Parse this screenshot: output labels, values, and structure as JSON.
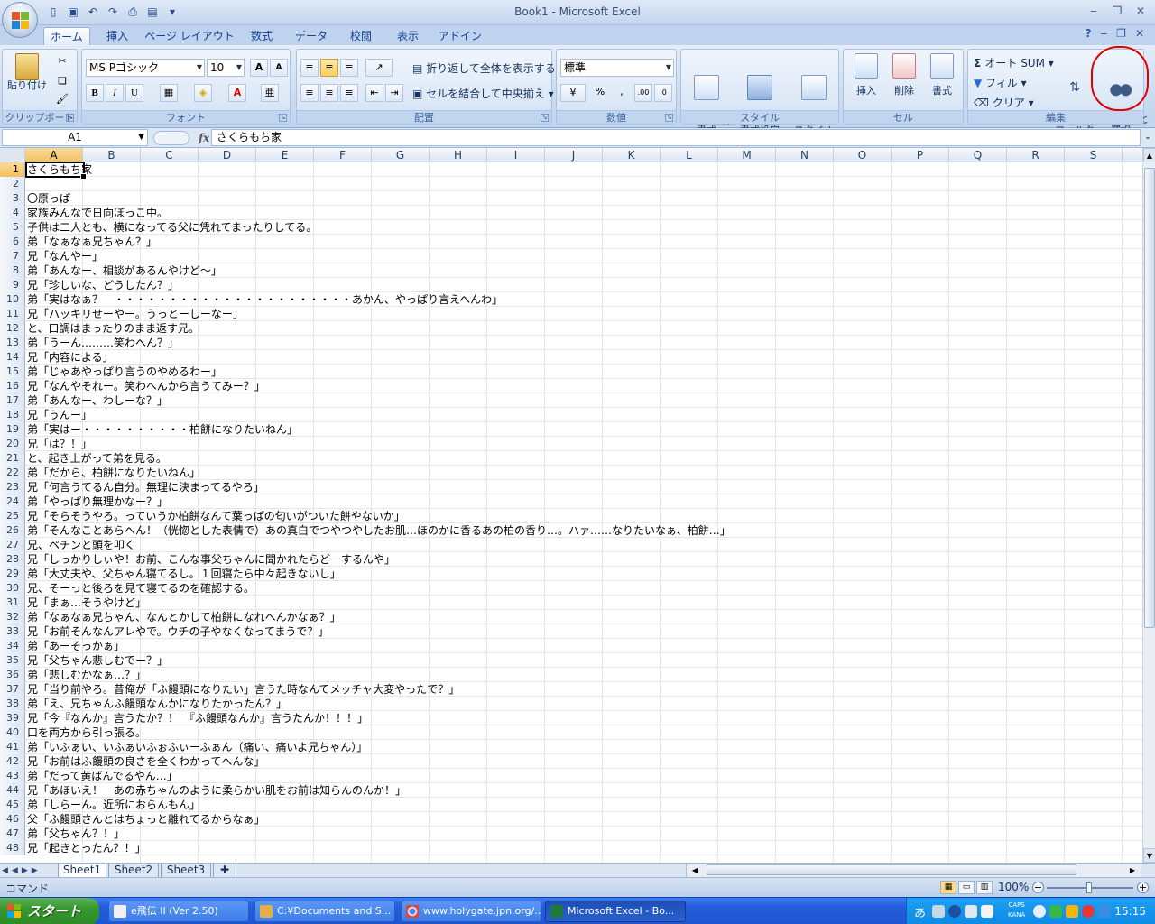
{
  "window": {
    "title": "Book1 - Microsoft Excel"
  },
  "ribbon": {
    "tabs": [
      "ホーム",
      "挿入",
      "ページ レイアウト",
      "数式",
      "データ",
      "校閲",
      "表示",
      "アドイン"
    ],
    "clipboard": {
      "paste": "貼り付け",
      "label": "クリップボード"
    },
    "font": {
      "name": "MS Pゴシック",
      "size": "10",
      "bold": "B",
      "italic": "I",
      "underline": "U",
      "label": "フォント"
    },
    "alignment": {
      "wrap": "折り返して全体を表示する",
      "merge": "セルを結合して中央揃え",
      "label": "配置"
    },
    "number": {
      "format": "標準",
      "percent": "%",
      "comma": ",",
      "label": "数値"
    },
    "styles": {
      "conditional": "条件付き\n書式",
      "table": "テーブルとして\n書式設定",
      "cell": "セルの\nスタイル",
      "label": "スタイル"
    },
    "cells": {
      "insert": "挿入",
      "delete": "削除",
      "format": "書式",
      "label": "セル"
    },
    "editing": {
      "autosum": "オート SUM",
      "fill": "フィル",
      "clear": "クリア",
      "sort": "並べ替えと\nフィルタ",
      "find": "検索と\n選択",
      "label": "編集"
    }
  },
  "formula_bar": {
    "name_box": "A1",
    "fx": "fx",
    "content": "さくらもち家"
  },
  "columns": [
    "A",
    "B",
    "C",
    "D",
    "E",
    "F",
    "G",
    "H",
    "I",
    "J",
    "K",
    "L",
    "M",
    "N",
    "O",
    "P",
    "Q",
    "R",
    "S"
  ],
  "rows": [
    {
      "n": "1",
      "text": "さくらもち家"
    },
    {
      "n": "2",
      "text": ""
    },
    {
      "n": "3",
      "text": "〇原っぱ"
    },
    {
      "n": "4",
      "text": "家族みんなで日向ぼっこ中。"
    },
    {
      "n": "5",
      "text": "子供は二人とも、横になってる父に凭れてまったりしてる。"
    },
    {
      "n": "6",
      "text": "弟「なぁなぁ兄ちゃん？」"
    },
    {
      "n": "7",
      "text": "兄「なんやー」"
    },
    {
      "n": "8",
      "text": "弟「あんなー、相談があるんやけど～」"
    },
    {
      "n": "9",
      "text": "兄「珍しいな、どうしたん？」"
    },
    {
      "n": "10",
      "text": "弟「実はなぁ？　・・・・・・・・・・・・・・・・・・・・・・あかん、やっぱり言えへんわ」"
    },
    {
      "n": "11",
      "text": "兄「ハッキリせーやー。うっとーしーなー」"
    },
    {
      "n": "12",
      "text": "と、口調はまったりのまま返す兄。"
    },
    {
      "n": "13",
      "text": "弟「うーん………笑わへん？」"
    },
    {
      "n": "14",
      "text": "兄「内容による」"
    },
    {
      "n": "15",
      "text": "弟「じゃあやっぱり言うのやめるわー」"
    },
    {
      "n": "16",
      "text": "兄「なんやそれー。笑わへんから言うてみー？」"
    },
    {
      "n": "17",
      "text": "弟「あんなー、わしーな？」"
    },
    {
      "n": "18",
      "text": "兄「うんー」"
    },
    {
      "n": "19",
      "text": "弟「実はー・・・・・・・・・・柏餅になりたいねん」"
    },
    {
      "n": "20",
      "text": "兄「は？！」"
    },
    {
      "n": "21",
      "text": "と、起き上がって弟を見る。"
    },
    {
      "n": "22",
      "text": "弟「だから、柏餅になりたいねん」"
    },
    {
      "n": "23",
      "text": "兄「何言うてるん自分。無理に決まってるやろ」"
    },
    {
      "n": "24",
      "text": "弟「やっぱり無理かなー？」"
    },
    {
      "n": "25",
      "text": "兄「そらそうやろ。っていうか柏餅なんて葉っぱの匂いがついた餅やないか」"
    },
    {
      "n": "26",
      "text": "弟「そんなことあらへん！（恍惚とした表情で）あの真白でつやつやしたお肌…ほのかに香るあの柏の香り…。ハァ……なりたいなぁ、柏餅…」"
    },
    {
      "n": "27",
      "text": "兄、ペチンと頭を叩く"
    },
    {
      "n": "28",
      "text": "兄「しっかりしぃや！お前、こんな事父ちゃんに聞かれたらどーするんや」"
    },
    {
      "n": "29",
      "text": "弟「大丈夫や、父ちゃん寝てるし。１回寝たら中々起きないし」"
    },
    {
      "n": "30",
      "text": "兄、そーっと後ろを見て寝てるのを確認する。"
    },
    {
      "n": "31",
      "text": "兄「まぁ…そうやけど」"
    },
    {
      "n": "32",
      "text": "弟「なぁなぁ兄ちゃん、なんとかして柏餅になれへんかなぁ？」"
    },
    {
      "n": "33",
      "text": "兄「お前そんなんアレやで。ウチの子やなくなってまうで？」"
    },
    {
      "n": "34",
      "text": "弟「あーそっかぁ」"
    },
    {
      "n": "35",
      "text": "兄「父ちゃん悲しむでー？」"
    },
    {
      "n": "36",
      "text": "弟「悲しむかなぁ…？」"
    },
    {
      "n": "37",
      "text": "兄「当り前やろ。昔俺が「ふ饅頭になりたい」言うた時なんてメッチャ大変やったで？」"
    },
    {
      "n": "38",
      "text": "弟「え、兄ちゃんふ饅頭なんかになりたかったん？」"
    },
    {
      "n": "39",
      "text": "兄「今『なんか』言うたか？！　『ふ饅頭なんか』言うたんか！！！」"
    },
    {
      "n": "40",
      "text": "口を両方から引っ張る。"
    },
    {
      "n": "41",
      "text": "弟「いふぁい、いふぁいふぉふぃーふぁん（痛い、痛いよ兄ちゃん）」"
    },
    {
      "n": "42",
      "text": "兄「お前はふ饅頭の良さを全くわかってへんな」"
    },
    {
      "n": "43",
      "text": "弟「だって黄ばんでるやん…」"
    },
    {
      "n": "44",
      "text": "兄「あほいえ！　あの赤ちゃんのように柔らかい肌をお前は知らんのんか！」"
    },
    {
      "n": "45",
      "text": "弟「しらーん。近所におらんもん」"
    },
    {
      "n": "46",
      "text": "父「ふ饅頭さんとはちょっと離れてるからなぁ」"
    },
    {
      "n": "47",
      "text": "弟「父ちゃん？！」"
    },
    {
      "n": "48",
      "text": "兄「起きとったん？！」"
    }
  ],
  "sheets": [
    "Sheet1",
    "Sheet2",
    "Sheet3"
  ],
  "status": {
    "mode": "コマンド",
    "zoom": "100%"
  },
  "taskbar": {
    "start": "スタート",
    "items": [
      "e飛伝 II (Ver 2.50)",
      "C:¥Documents and S...",
      "www.holygate.jpn.org/...",
      "Microsoft Excel - Bo..."
    ],
    "clock": "15:15",
    "caps": "CAPS",
    "kana": "KANA"
  }
}
